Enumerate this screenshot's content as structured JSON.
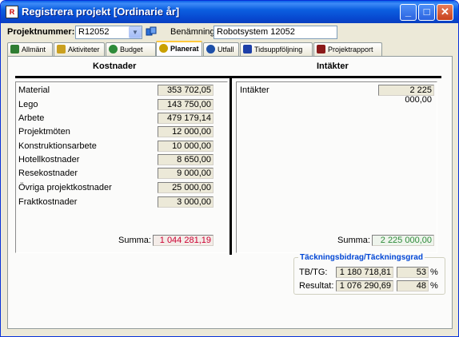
{
  "window": {
    "title": "Registrera projekt [Ordinarie år]",
    "icon": "app-icon",
    "controls": [
      "_",
      "□",
      "✕"
    ]
  },
  "header": {
    "project_number_label": "Projektnummer:",
    "project_number_value": "R12052",
    "name_label": "Benämning",
    "name_value": "Robotsystem 12052"
  },
  "tabs": [
    {
      "label": "Allmänt",
      "icon": "info-icon",
      "color": "#2f7d32"
    },
    {
      "label": "Aktiviteter",
      "icon": "folder-icon",
      "color": "#caa020"
    },
    {
      "label": "Budget",
      "icon": "money-bag-icon",
      "color": "#2e8b3a"
    },
    {
      "label": "Planerat",
      "icon": "money-bag-icon",
      "color": "#c9a000"
    },
    {
      "label": "Utfall",
      "icon": "people-icon",
      "color": "#1d4fa8"
    },
    {
      "label": "Tidsuppföljning",
      "icon": "clock-icon",
      "color": "#1d3fa8"
    },
    {
      "label": "Projektrapport",
      "icon": "report-icon",
      "color": "#8b1a1a"
    }
  ],
  "costs": {
    "heading": "Kostnader",
    "rows": [
      {
        "label": "Material",
        "value": "353 702,05"
      },
      {
        "label": "Lego",
        "value": "143 750,00"
      },
      {
        "label": "Arbete",
        "value": "479 179,14"
      },
      {
        "label": "Projektmöten",
        "value": "12 000,00"
      },
      {
        "label": "Konstruktionsarbete",
        "value": "10 000,00"
      },
      {
        "label": "Hotellkostnader",
        "value": "8 650,00"
      },
      {
        "label": "Resekostnader",
        "value": "9 000,00"
      },
      {
        "label": "Övriga projektkostnader",
        "value": "25 000,00"
      },
      {
        "label": "Fraktkostnader",
        "value": "3 000,00"
      }
    ],
    "sum_label": "Summa:",
    "sum_value": "1 044 281,19",
    "sum_color": "#cc0033"
  },
  "income": {
    "heading": "Intäkter",
    "rows": [
      {
        "label": "Intäkter",
        "value": "2 225 000,00"
      }
    ],
    "sum_label": "Summa:",
    "sum_value": "2 225 000,00",
    "sum_color": "#2e8b3a"
  },
  "contribution": {
    "title": "Täckningsbidrag/Täckningsgrad",
    "tb_label": "TB/TG:",
    "tb_value": "1 180 718,81",
    "tg_value": "53",
    "result_label": "Resultat:",
    "result_value": "1 076 290,69",
    "result_pct": "48",
    "pct_sign": "%"
  }
}
